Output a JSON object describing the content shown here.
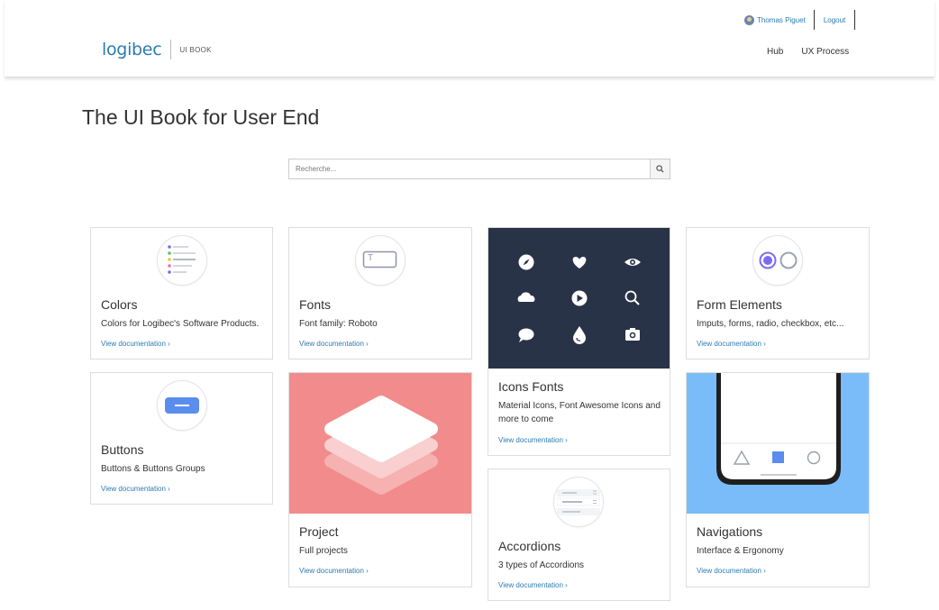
{
  "header": {
    "logo_text": "logibec",
    "logo_sub": "UI BOOK",
    "user_name": "Thomas Piguet",
    "logout": "Logout",
    "nav": [
      "Hub",
      "UX Process"
    ]
  },
  "page_title": "The UI Book for User End",
  "search": {
    "placeholder": "Recherche..."
  },
  "link_label": "View documentation",
  "cards": {
    "colors": {
      "title": "Colors",
      "desc": "Colors for Logibec's Software Products.",
      "icon": "colors-list-icon"
    },
    "fonts": {
      "title": "Fonts",
      "desc": "Font family: Roboto",
      "icon": "text-field-icon",
      "icon_letter": "T"
    },
    "icons_fonts": {
      "title": "Icons Fonts",
      "desc": "Material Icons, Font Awesome Icons and more to come",
      "icon": "icon-grid",
      "banner_color": "#283347"
    },
    "form_elements": {
      "title": "Form Elements",
      "desc": "Imputs, forms, radio, checkbox, etc...",
      "icon": "radio-buttons-icon"
    },
    "buttons": {
      "title": "Buttons",
      "desc": "Buttons & Buttons Groups",
      "icon": "button-icon"
    },
    "project": {
      "title": "Project",
      "desc": "Full projects",
      "icon": "stacked-layers-icon",
      "banner_color": "#f28b8b"
    },
    "accordions": {
      "title": "Accordions",
      "desc": "3 types of Accordions",
      "icon": "accordion-icon"
    },
    "navigations": {
      "title": "Navigations",
      "desc": "Interface & Ergonomy",
      "icon": "phone-nav-icon",
      "banner_color": "#7abcfa"
    }
  },
  "colors": {
    "link": "#2c7cb0",
    "accent": "#5b8def",
    "dark": "#283347"
  }
}
